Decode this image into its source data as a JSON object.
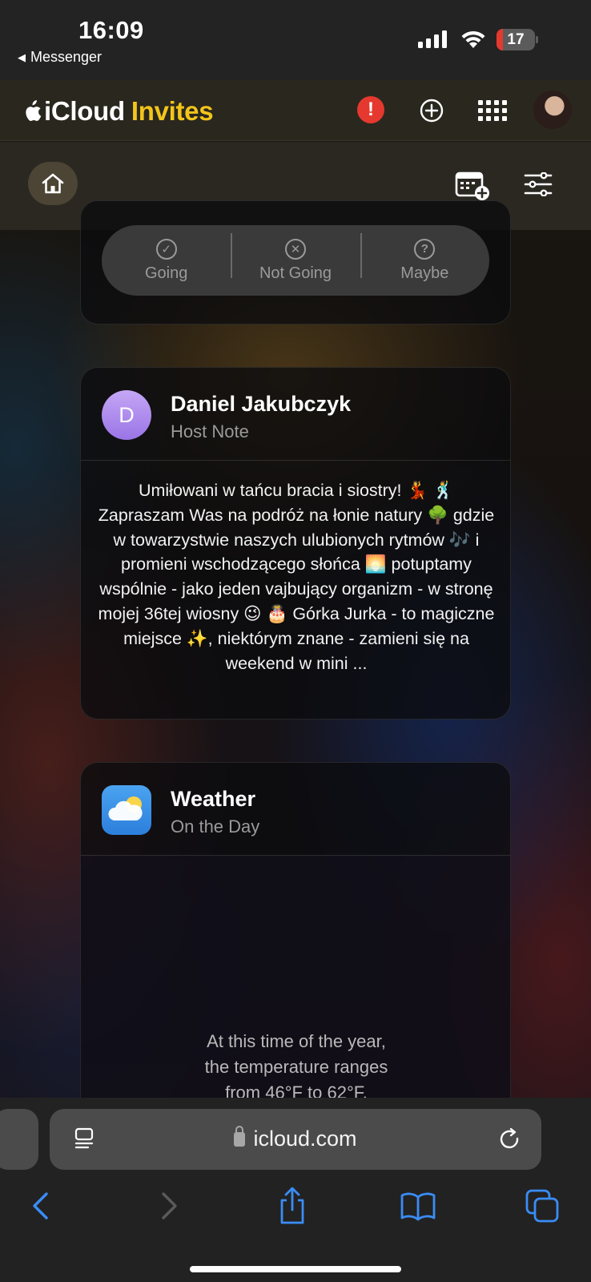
{
  "status_bar": {
    "time": "16:09",
    "back_app": "Messenger",
    "battery": "17",
    "battery_level": 0.17
  },
  "app_header": {
    "brand_icloud": "iCloud",
    "brand_invites": "Invites",
    "alert_symbol": "!",
    "accent_color": "#f2c51b",
    "alert_color": "#e5392f"
  },
  "rsvp": {
    "going": "Going",
    "not_going": "Not Going",
    "maybe": "Maybe"
  },
  "host_note": {
    "initial": "D",
    "name": "Daniel Jakubczyk",
    "subtitle": "Host Note",
    "text": "Umiłowani w tańcu bracia i siostry! 💃 🕺 Zapraszam Was na podróż na łonie natury 🌳 gdzie w towarzystwie naszych ulubionych rytmów 🎶 i promieni wschodzącego słońca 🌅 potuptamy wspólnie - jako jeden vajbujący organizm - w stronę mojej 36tej wiosny 😉 🎂 Górka Jurka - to magiczne miejsce ✨, niektórym znane - zamieni się na weekend w mini ..."
  },
  "weather": {
    "title": "Weather",
    "subtitle": "On the Day",
    "line1": "At this time of the year,",
    "line2": "the temperature ranges",
    "line3": "from 46°F to 62°F."
  },
  "browser": {
    "url": "icloud.com"
  },
  "icons": [
    "apple-icon",
    "alert-icon",
    "add-icon",
    "apps-grid-icon",
    "home-icon",
    "calendar-add-icon",
    "filter-sliders-icon",
    "reader-icon",
    "lock-icon",
    "reload-icon",
    "back-icon",
    "forward-icon",
    "share-icon",
    "bookmarks-icon",
    "tabs-icon"
  ]
}
